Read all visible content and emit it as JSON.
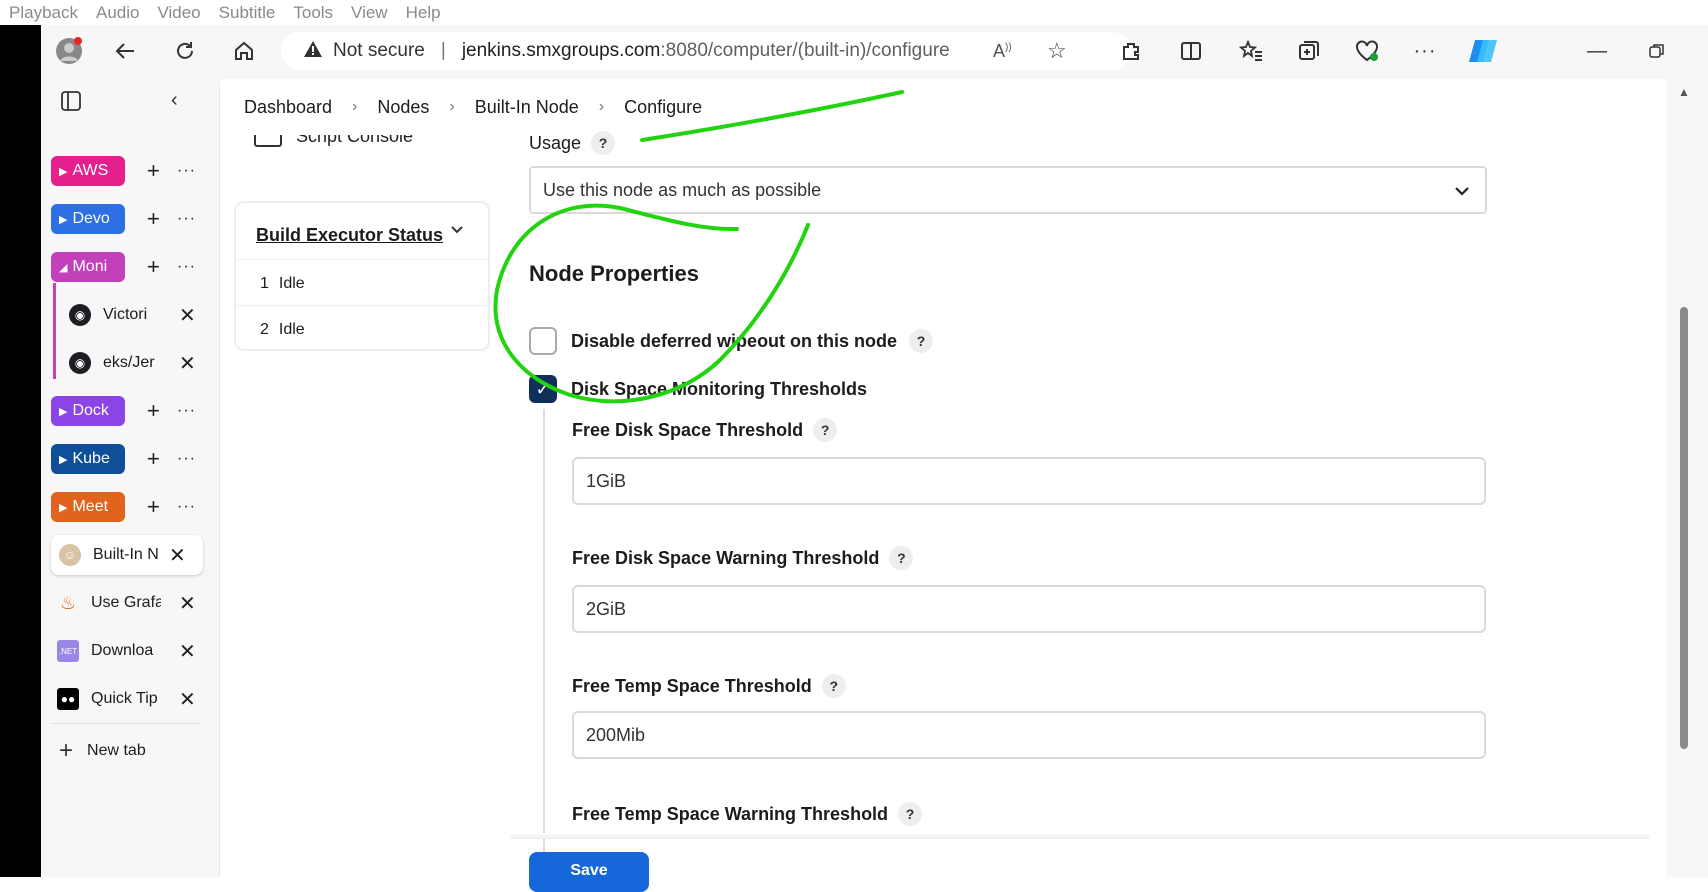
{
  "menubar": [
    "Playback",
    "Audio",
    "Video",
    "Subtitle",
    "Tools",
    "View",
    "Help"
  ],
  "address": {
    "not_secure": "Not secure",
    "host": "jenkins.smxgroups.com",
    "path": ":8080/computer/(built-in)/configure"
  },
  "sidebar": {
    "groups": [
      {
        "label": "AWS",
        "color": "#e5208d"
      },
      {
        "label": "Devo",
        "color": "#2f6fe4"
      },
      {
        "label": "Moni",
        "color": "#c241bb"
      },
      {
        "label": "Dock",
        "color": "#8b44e6"
      },
      {
        "label": "Kube",
        "color": "#0f4f9a"
      },
      {
        "label": "Meet",
        "color": "#e0641d"
      }
    ],
    "tabs": [
      "Victori",
      "eks/Jer",
      "Built-In N",
      "Use Grafa",
      "Downloa",
      "Quick Tip"
    ],
    "new_tab": "New tab"
  },
  "breadcrumb": [
    "Dashboard",
    "Nodes",
    "Built-In Node",
    "Configure"
  ],
  "left_panel": {
    "script_console": "Script Console",
    "executor_title": "Build Executor Status",
    "executors": [
      {
        "num": "1",
        "state": "Idle"
      },
      {
        "num": "2",
        "state": "Idle"
      }
    ]
  },
  "form": {
    "usage_label": "Usage",
    "usage_value": "Use this node as much as possible",
    "node_properties": "Node Properties",
    "disable_wipeout": "Disable deferred wipeout on this node",
    "disk_monitor": "Disk Space Monitoring Thresholds",
    "free_disk_label": "Free Disk Space Threshold",
    "free_disk_value": "1GiB",
    "free_disk_warn_label": "Free Disk Space Warning Threshold",
    "free_disk_warn_value": "2GiB",
    "free_temp_label": "Free Temp Space Threshold",
    "free_temp_value": "200Mib",
    "free_temp_warn_label": "Free Temp Space Warning Threshold",
    "save": "Save",
    "help": "?"
  },
  "colors": {
    "accent": "#10305a",
    "save": "#1667d9",
    "annotation": "#22d40f"
  }
}
